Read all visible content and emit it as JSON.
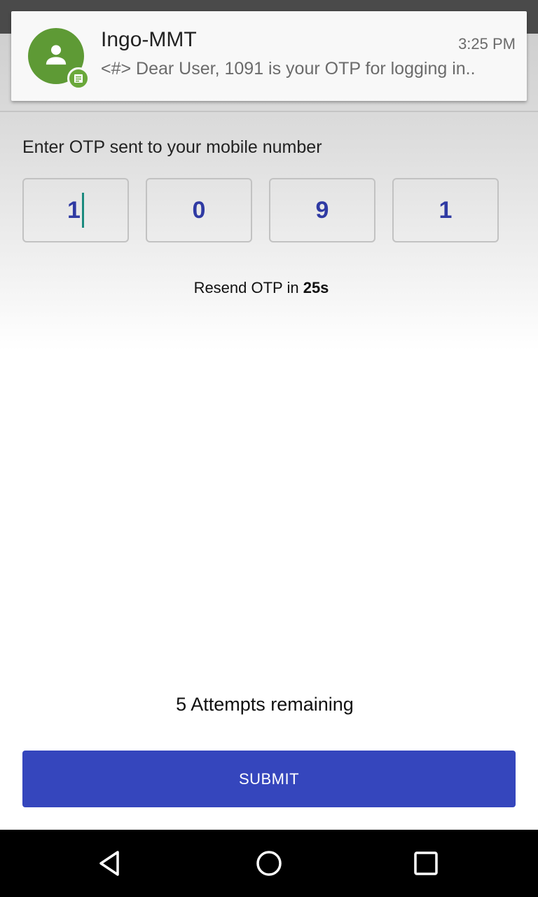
{
  "notification": {
    "sender": "Ingo-MMT",
    "time": "3:25 PM",
    "message": "<#> Dear User,  1091 is your OTP for logging in..",
    "avatar_icon": "person-icon",
    "badge_icon": "message-icon",
    "avatar_color": "#5e9a35"
  },
  "otp": {
    "label": "Enter OTP sent to your mobile number",
    "digits": [
      "1",
      "0",
      "9",
      "1"
    ],
    "digit_color": "#2f3aa3",
    "resend_prefix": "Resend OTP in",
    "resend_countdown": "25s"
  },
  "attempts_text": "5 Attempts remaining",
  "submit_label": "SUBMIT",
  "submit_color": "#3546bd",
  "navbar": {
    "back_icon": "back-triangle-icon",
    "home_icon": "home-circle-icon",
    "recent_icon": "recent-apps-square-icon"
  }
}
